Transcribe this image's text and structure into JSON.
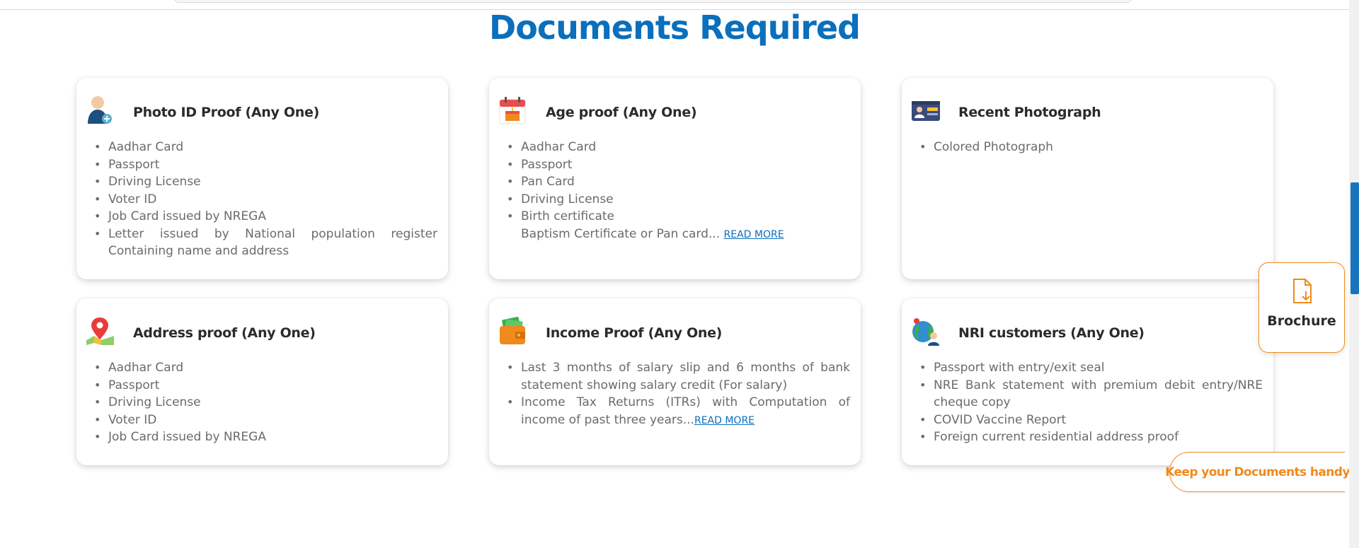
{
  "page": {
    "title": "Documents Required"
  },
  "cards": [
    {
      "title": "Photo ID Proof (Any One)",
      "icon": "person-id-icon",
      "items": [
        "Aadhar Card",
        "Passport",
        "Driving License",
        "Voter ID",
        "Job Card issued by NREGA",
        "Letter issued by National population register Containing name and address"
      ]
    },
    {
      "title": "Age proof (Any One)",
      "icon": "calendar-icon",
      "items": [
        "Aadhar Card",
        "Passport",
        "Pan Card",
        "Driving License",
        "Birth certificate"
      ],
      "extra_text": "Baptism Certificate or Pan card...",
      "read_more": "READ MORE"
    },
    {
      "title": "Recent Photograph",
      "icon": "id-card-icon",
      "items": [
        "Colored Photograph"
      ]
    },
    {
      "title": "Address proof (Any One)",
      "icon": "map-pin-icon",
      "items": [
        "Aadhar Card",
        "Passport",
        "Driving License",
        "Voter ID",
        "Job Card issued by NREGA"
      ]
    },
    {
      "title": "Income Proof (Any One)",
      "icon": "wallet-icon",
      "items": [
        "Last 3 months of salary slip and 6 months of bank statement showing salary credit (For salary)",
        "Income Tax Returns (ITRs) with Computation of income of past three years..."
      ],
      "read_more": "READ MORE"
    },
    {
      "title": "NRI customers (Any One)",
      "icon": "globe-person-icon",
      "items": [
        "Passport with entry/exit seal",
        "NRE Bank statement with premium debit entry/NRE cheque copy",
        "COVID Vaccine Report",
        "Foreign current residential address proof"
      ]
    }
  ],
  "floating": {
    "brochure_label": "Brochure",
    "docs_handy_label": "Keep your Documents handy",
    "accent_color": "#f08a1c"
  },
  "colors": {
    "title_blue": "#0a6fbc",
    "scrollbar_thumb": "#1874bd"
  }
}
